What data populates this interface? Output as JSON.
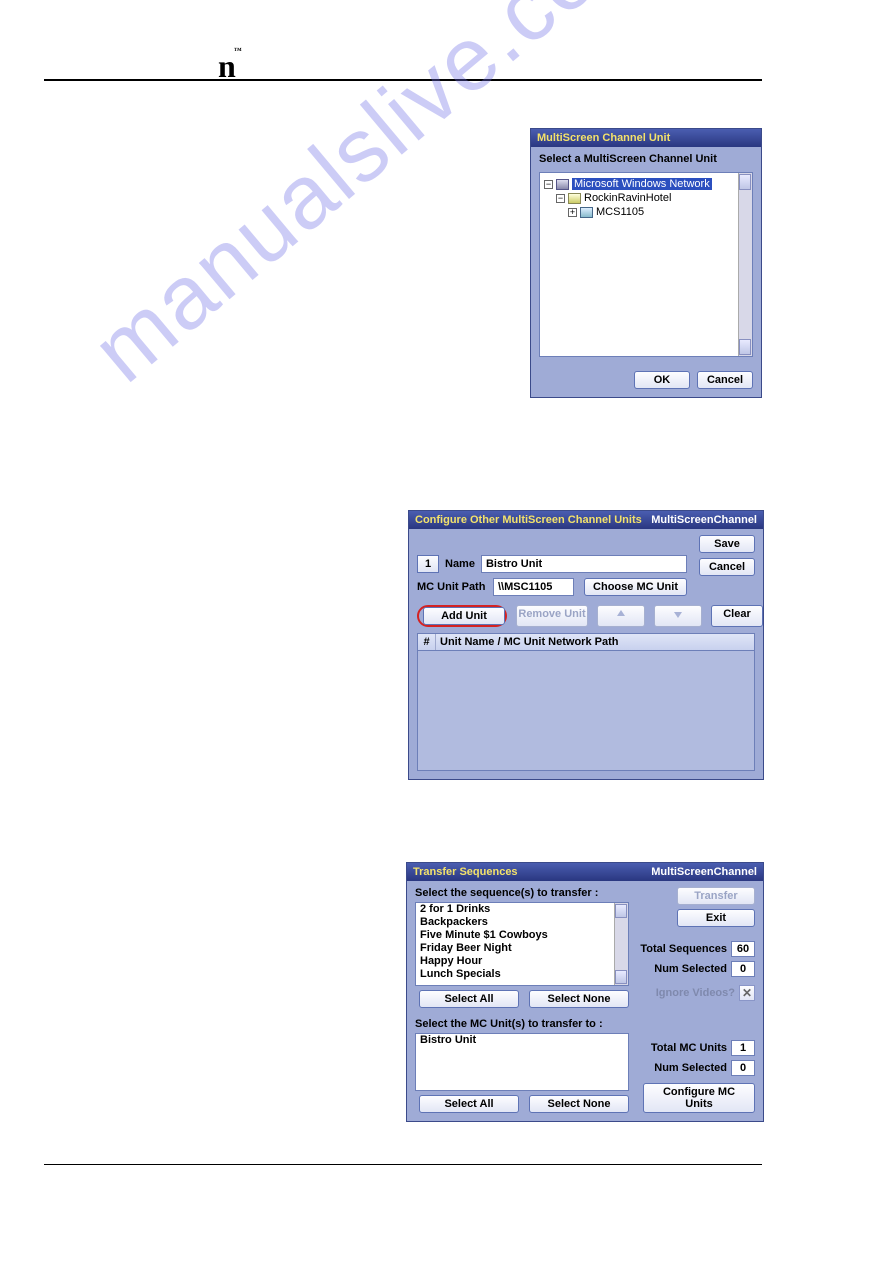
{
  "watermark": "manualslive.com",
  "header": {
    "logo": "n"
  },
  "dialog1": {
    "title": "MultiScreen Channel Unit",
    "prompt": "Select a MultiScreen Channel Unit",
    "tree": [
      {
        "label": "Microsoft Windows Network",
        "level": 0,
        "selected": true,
        "open": true,
        "icon": "net"
      },
      {
        "label": "RockinRavinHotel",
        "level": 1,
        "selected": false,
        "open": true,
        "icon": "wg"
      },
      {
        "label": "MCS1105",
        "level": 2,
        "selected": false,
        "open": false,
        "icon": "comp"
      }
    ],
    "ok": "OK",
    "cancel": "Cancel"
  },
  "dialog2": {
    "title": "Configure Other MultiScreen Channel Units",
    "brand": "MultiScreenChannel",
    "save": "Save",
    "cancel": "Cancel",
    "index": "1",
    "name_label": "Name",
    "name_value": "Bistro Unit",
    "path_label": "MC Unit Path",
    "path_value": "\\\\MSC1105",
    "choose": "Choose MC Unit",
    "add": "Add Unit",
    "remove": "Remove Unit",
    "clear": "Clear",
    "grid_col1": "#",
    "grid_col2": "Unit Name / MC Unit Network Path"
  },
  "dialog3": {
    "title": "Transfer Sequences",
    "brand": "MultiScreenChannel",
    "seq_prompt": "Select the sequence(s) to transfer :",
    "sequences": [
      "2 for 1 Drinks",
      "Backpackers",
      "Five Minute $1 Cowboys",
      "Friday Beer Night",
      "Happy Hour",
      "Lunch Specials"
    ],
    "select_all": "Select All",
    "select_none": "Select None",
    "transfer": "Transfer",
    "exit": "Exit",
    "total_seq_label": "Total Sequences",
    "total_seq_value": "60",
    "num_sel_label": "Num Selected",
    "num_sel_value": "0",
    "ignore_label": "Ignore Videos?",
    "unit_prompt": "Select the MC Unit(s) to transfer to :",
    "units": [
      "Bistro Unit"
    ],
    "total_units_label": "Total MC Units",
    "total_units_value": "1",
    "units_sel_label": "Num Selected",
    "units_sel_value": "0",
    "configure": "Configure MC Units"
  }
}
